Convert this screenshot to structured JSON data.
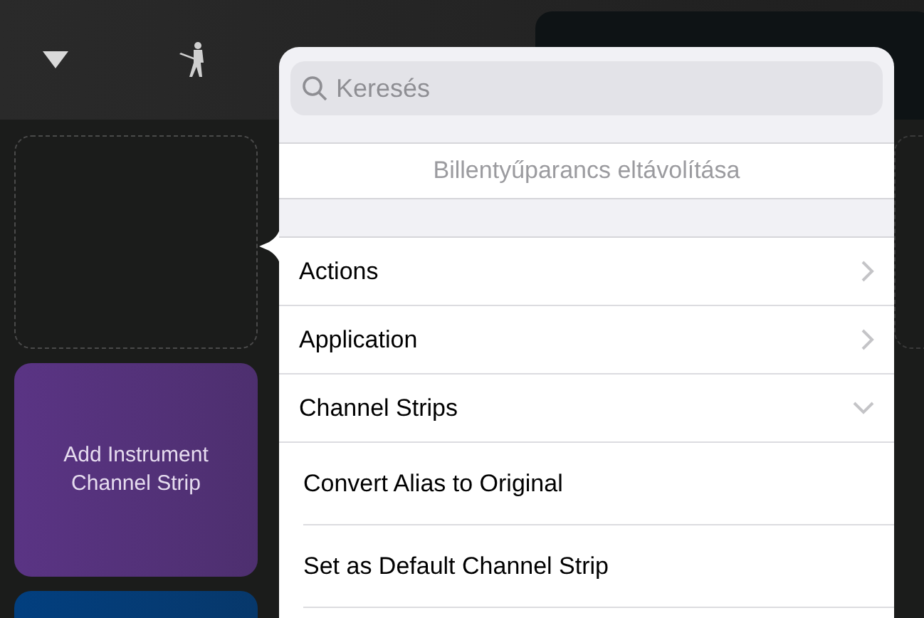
{
  "tiles": [
    {
      "kind": "empty"
    },
    {
      "kind": "action",
      "label": "Add Instrument Channel Strip",
      "color": "#5a3484"
    },
    {
      "kind": "action",
      "color": "#023f7f"
    }
  ],
  "popover": {
    "search": {
      "placeholder": "Keresés"
    },
    "remove_shortcut": "Billentyűparancs eltávolítása",
    "items": [
      {
        "kind": "submenu",
        "label": "Actions"
      },
      {
        "kind": "submenu",
        "label": "Application"
      },
      {
        "kind": "group",
        "label": "Channel Strips",
        "expanded": true,
        "children": [
          {
            "label": "Convert Alias to Original"
          },
          {
            "label": "Set as Default Channel Strip"
          }
        ]
      }
    ]
  }
}
